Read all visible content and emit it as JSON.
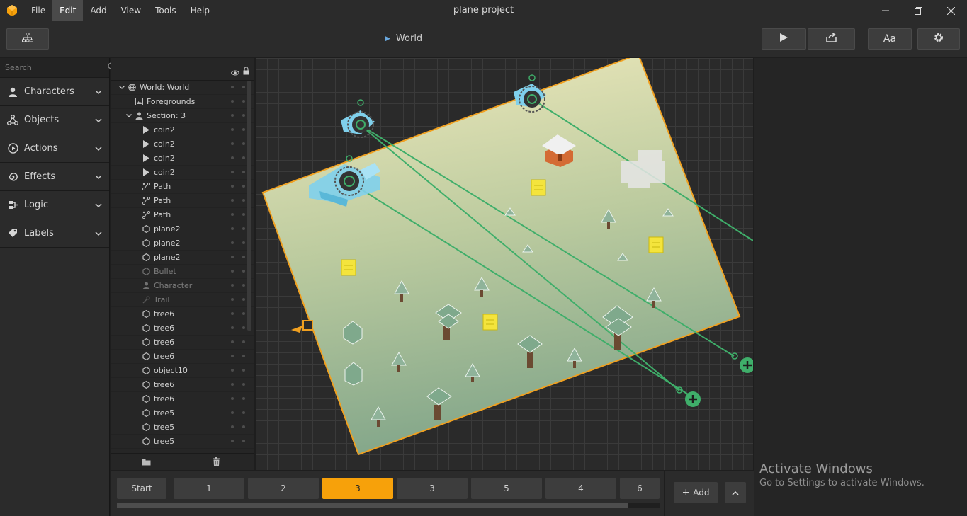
{
  "window": {
    "title": "plane project"
  },
  "menu": [
    "File",
    "Edit",
    "Add",
    "View",
    "Tools",
    "Help"
  ],
  "toolbar": {
    "breadcrumb": "World",
    "font_button": "Aa"
  },
  "search": {
    "placeholder": "Search"
  },
  "categories": [
    {
      "label": "Characters",
      "icon": "person-icon"
    },
    {
      "label": "Objects",
      "icon": "objects-icon"
    },
    {
      "label": "Actions",
      "icon": "play-circle-icon"
    },
    {
      "label": "Effects",
      "icon": "spiral-icon"
    },
    {
      "label": "Logic",
      "icon": "logic-icon"
    },
    {
      "label": "Labels",
      "icon": "tag-icon"
    }
  ],
  "hierarchy": [
    {
      "label": "World: World",
      "icon": "globe-icon",
      "level": 0,
      "toggle": true,
      "dim": false
    },
    {
      "label": "Foregrounds",
      "icon": "image-icon",
      "level": 1,
      "toggle": false,
      "dim": false
    },
    {
      "label": "Section: 3",
      "icon": "person-icon",
      "level": 1,
      "toggle": true,
      "dim": false
    },
    {
      "label": "coin2",
      "icon": "play-icon",
      "level": 2,
      "toggle": false,
      "dim": false
    },
    {
      "label": "coin2",
      "icon": "play-icon",
      "level": 2,
      "toggle": false,
      "dim": false
    },
    {
      "label": "coin2",
      "icon": "play-icon",
      "level": 2,
      "toggle": false,
      "dim": false
    },
    {
      "label": "coin2",
      "icon": "play-icon",
      "level": 2,
      "toggle": false,
      "dim": false
    },
    {
      "label": "Path",
      "icon": "path-icon",
      "level": 2,
      "toggle": false,
      "dim": false
    },
    {
      "label": "Path",
      "icon": "path-icon",
      "level": 2,
      "toggle": false,
      "dim": false
    },
    {
      "label": "Path",
      "icon": "path-icon",
      "level": 2,
      "toggle": false,
      "dim": false
    },
    {
      "label": "plane2",
      "icon": "hexagon-icon",
      "level": 2,
      "toggle": false,
      "dim": false
    },
    {
      "label": "plane2",
      "icon": "hexagon-icon",
      "level": 2,
      "toggle": false,
      "dim": false
    },
    {
      "label": "plane2",
      "icon": "hexagon-icon",
      "level": 2,
      "toggle": false,
      "dim": false
    },
    {
      "label": "Bullet",
      "icon": "hexagon-icon",
      "level": 2,
      "toggle": false,
      "dim": true
    },
    {
      "label": "Character",
      "icon": "person-icon",
      "level": 2,
      "toggle": false,
      "dim": true
    },
    {
      "label": "Trail",
      "icon": "trail-icon",
      "level": 2,
      "toggle": false,
      "dim": true
    },
    {
      "label": "tree6",
      "icon": "hexagon-icon",
      "level": 2,
      "toggle": false,
      "dim": false
    },
    {
      "label": "tree6",
      "icon": "hexagon-icon",
      "level": 2,
      "toggle": false,
      "dim": false
    },
    {
      "label": "tree6",
      "icon": "hexagon-icon",
      "level": 2,
      "toggle": false,
      "dim": false
    },
    {
      "label": "tree6",
      "icon": "hexagon-icon",
      "level": 2,
      "toggle": false,
      "dim": false
    },
    {
      "label": "object10",
      "icon": "hexagon-icon",
      "level": 2,
      "toggle": false,
      "dim": false
    },
    {
      "label": "tree6",
      "icon": "hexagon-icon",
      "level": 2,
      "toggle": false,
      "dim": false
    },
    {
      "label": "tree6",
      "icon": "hexagon-icon",
      "level": 2,
      "toggle": false,
      "dim": false
    },
    {
      "label": "tree5",
      "icon": "hexagon-icon",
      "level": 2,
      "toggle": false,
      "dim": false
    },
    {
      "label": "tree5",
      "icon": "hexagon-icon",
      "level": 2,
      "toggle": false,
      "dim": false
    },
    {
      "label": "tree5",
      "icon": "hexagon-icon",
      "level": 2,
      "toggle": false,
      "dim": false
    }
  ],
  "sections": [
    {
      "label": "Start",
      "active": false
    },
    {
      "label": "1",
      "active": false
    },
    {
      "label": "2",
      "active": false
    },
    {
      "label": "3",
      "active": true
    },
    {
      "label": "3",
      "active": false
    },
    {
      "label": "5",
      "active": false
    },
    {
      "label": "4",
      "active": false
    },
    {
      "label": "6",
      "active": false
    }
  ],
  "bottom": {
    "add_label": "Add"
  },
  "activation": {
    "title": "Activate Windows",
    "subtitle": "Go to Settings to activate Windows."
  },
  "colors": {
    "accent": "#f7a10a",
    "path": "#3fae6a",
    "plane": "#7fd0ec",
    "coin": "#f4e43c"
  }
}
